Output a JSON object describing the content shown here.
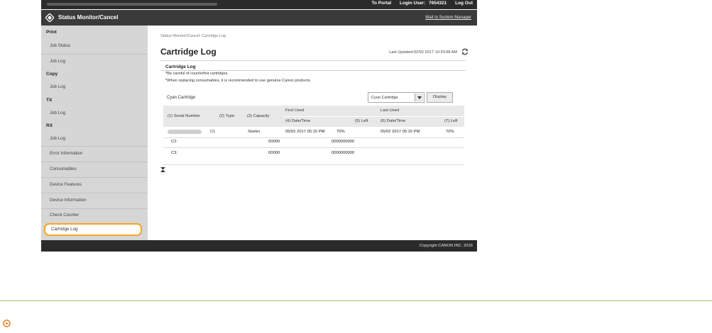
{
  "topbar": {
    "to_portal": "To Portal",
    "login_user_label": "Login User:",
    "login_user_value": "7654321",
    "logout": "Log Out"
  },
  "header": {
    "title": "Status Monitor/Cancel",
    "mail_link": "Mail to System Manager"
  },
  "sidebar": {
    "print": {
      "category": "Print",
      "items": [
        "Job Status",
        "Job Log"
      ]
    },
    "copy": {
      "category": "Copy",
      "items": [
        "Job Log"
      ]
    },
    "tx": {
      "category": "TX",
      "items": [
        "Job Log"
      ]
    },
    "rx": {
      "category": "RX",
      "items": [
        "Job Log"
      ]
    },
    "others": [
      "Error Information",
      "Consumables",
      "Device Features",
      "Device Information",
      "Check Counter",
      "Cartridge Log"
    ]
  },
  "main": {
    "breadcrumb": "Status Monitor/Cancel: Cartridge Log",
    "title": "Cartridge Log",
    "last_updated": "Last Updated:02/02 2017 10:33:08 AM",
    "section_title": "Cartridge Log",
    "notes": [
      "*Be careful of counterfeit cartridges.",
      "*When replacing consumables, it is recommended to use genuine Canon products."
    ],
    "cartridge_label": "Cyan Cartridge",
    "select_value": "Cyan Cartridge",
    "display_button": "Display",
    "table": {
      "headers": {
        "serial": "(1) Serial Number",
        "type": "(2) Type",
        "capacity": "(3) Capacity",
        "first_used": "First Used",
        "first_datetime": "(4) Date/Time",
        "first_left": "(5) Left",
        "last_used": "Last Used",
        "last_datetime": "(6) Date/Time",
        "last_left": "(7) Left"
      },
      "row": {
        "type": "C1",
        "capacity": "Starter",
        "first_datetime": "05/02 2017 05:15 PM",
        "first_left": "70%",
        "last_datetime": "05/02 2017 05:15 PM",
        "last_left": "70%"
      },
      "c2": {
        "label": "C2:",
        "value1": "00000",
        "value2": "0000000000"
      },
      "c3": {
        "label": "C3:",
        "value1": "00000",
        "value2": "0000000000"
      }
    }
  },
  "footer": {
    "copyright": "Copyright CANON INC. 2016"
  },
  "colors": {
    "active_outline": "#f5a623",
    "rule_green": "#9ccc65",
    "circle_icon": "#e67e22"
  }
}
